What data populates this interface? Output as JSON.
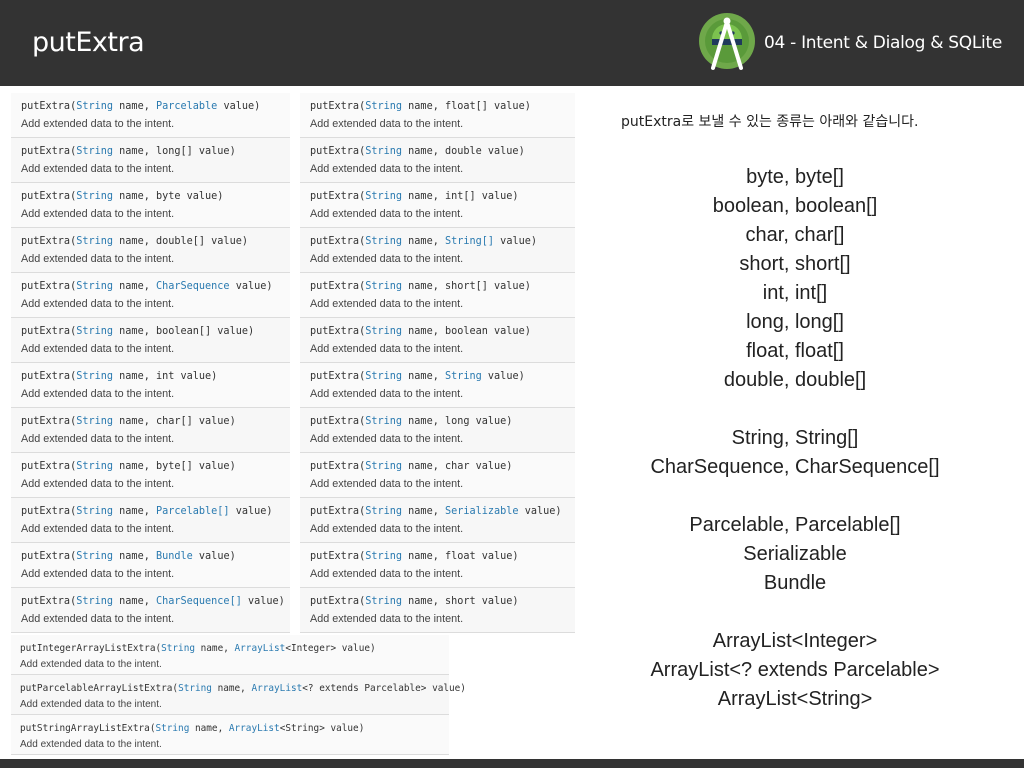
{
  "header": {
    "title": "putExtra",
    "chapter": "04 - Intent & Dialog & SQLite",
    "logo_icon": "android-studio-logo-icon",
    "background_color": "#333333"
  },
  "left_column": [
    {
      "method": "putExtra",
      "pre": "(",
      "type": "String",
      "mid": " name, ",
      "ptype": "Parcelable",
      "post": " value)",
      "desc": "Add extended data to the intent."
    },
    {
      "method": "putExtra",
      "pre": "(",
      "type": "String",
      "mid": " name, ",
      "ptype": "",
      "post": "long[] value)",
      "desc": "Add extended data to the intent."
    },
    {
      "method": "putExtra",
      "pre": "(",
      "type": "String",
      "mid": " name, ",
      "ptype": "",
      "post": "byte value)",
      "desc": "Add extended data to the intent."
    },
    {
      "method": "putExtra",
      "pre": "(",
      "type": "String",
      "mid": " name, ",
      "ptype": "",
      "post": "double[] value)",
      "desc": "Add extended data to the intent."
    },
    {
      "method": "putExtra",
      "pre": "(",
      "type": "String",
      "mid": " name, ",
      "ptype": "CharSequence",
      "post": " value)",
      "desc": "Add extended data to the intent."
    },
    {
      "method": "putExtra",
      "pre": "(",
      "type": "String",
      "mid": " name, ",
      "ptype": "",
      "post": "boolean[] value)",
      "desc": "Add extended data to the intent."
    },
    {
      "method": "putExtra",
      "pre": "(",
      "type": "String",
      "mid": " name, ",
      "ptype": "",
      "post": "int value)",
      "desc": "Add extended data to the intent."
    },
    {
      "method": "putExtra",
      "pre": "(",
      "type": "String",
      "mid": " name, ",
      "ptype": "",
      "post": "char[] value)",
      "desc": "Add extended data to the intent."
    },
    {
      "method": "putExtra",
      "pre": "(",
      "type": "String",
      "mid": " name, ",
      "ptype": "",
      "post": "byte[] value)",
      "desc": "Add extended data to the intent."
    },
    {
      "method": "putExtra",
      "pre": "(",
      "type": "String",
      "mid": " name, ",
      "ptype": "Parcelable[]",
      "post": " value)",
      "desc": "Add extended data to the intent."
    },
    {
      "method": "putExtra",
      "pre": "(",
      "type": "String",
      "mid": " name, ",
      "ptype": "Bundle",
      "post": " value)",
      "desc": "Add extended data to the intent."
    },
    {
      "method": "putExtra",
      "pre": "(",
      "type": "String",
      "mid": " name, ",
      "ptype": "CharSequence[]",
      "post": " value)",
      "desc": "Add extended data to the intent."
    }
  ],
  "right_column": [
    {
      "method": "putExtra",
      "pre": "(",
      "type": "String",
      "mid": " name, ",
      "ptype": "",
      "post": "float[] value)",
      "desc": "Add extended data to the intent."
    },
    {
      "method": "putExtra",
      "pre": "(",
      "type": "String",
      "mid": " name, ",
      "ptype": "",
      "post": "double value)",
      "desc": "Add extended data to the intent."
    },
    {
      "method": "putExtra",
      "pre": "(",
      "type": "String",
      "mid": " name, ",
      "ptype": "",
      "post": "int[] value)",
      "desc": "Add extended data to the intent."
    },
    {
      "method": "putExtra",
      "pre": "(",
      "type": "String",
      "mid": " name, ",
      "ptype": "String[]",
      "post": " value)",
      "desc": "Add extended data to the intent."
    },
    {
      "method": "putExtra",
      "pre": "(",
      "type": "String",
      "mid": " name, ",
      "ptype": "",
      "post": "short[] value)",
      "desc": "Add extended data to the intent."
    },
    {
      "method": "putExtra",
      "pre": "(",
      "type": "String",
      "mid": " name, ",
      "ptype": "",
      "post": "boolean value)",
      "desc": "Add extended data to the intent."
    },
    {
      "method": "putExtra",
      "pre": "(",
      "type": "String",
      "mid": " name, ",
      "ptype": "String",
      "post": " value)",
      "desc": "Add extended data to the intent."
    },
    {
      "method": "putExtra",
      "pre": "(",
      "type": "String",
      "mid": " name, ",
      "ptype": "",
      "post": "long value)",
      "desc": "Add extended data to the intent."
    },
    {
      "method": "putExtra",
      "pre": "(",
      "type": "String",
      "mid": " name, ",
      "ptype": "",
      "post": "char value)",
      "desc": "Add extended data to the intent."
    },
    {
      "method": "putExtra",
      "pre": "(",
      "type": "String",
      "mid": " name, ",
      "ptype": "Serializable",
      "post": " value)",
      "desc": "Add extended data to the intent."
    },
    {
      "method": "putExtra",
      "pre": "(",
      "type": "String",
      "mid": " name, ",
      "ptype": "",
      "post": "float value)",
      "desc": "Add extended data to the intent."
    },
    {
      "method": "putExtra",
      "pre": "(",
      "type": "String",
      "mid": " name, ",
      "ptype": "",
      "post": "short value)",
      "desc": "Add extended data to the intent."
    }
  ],
  "bottom_column": [
    {
      "method": "putIntegerArrayListExtra",
      "pre": "(",
      "type": "String",
      "mid": " name, ",
      "ptype": "ArrayList",
      "post": "<Integer> value)",
      "desc": "Add extended data to the intent."
    },
    {
      "method": "putParcelableArrayListExtra",
      "pre": "(",
      "type": "String",
      "mid": " name, ",
      "ptype": "ArrayList",
      "post": "<? extends Parcelable> value)",
      "desc": "Add extended data to the intent."
    },
    {
      "method": "putStringArrayListExtra",
      "pre": "(",
      "type": "String",
      "mid": " name, ",
      "ptype": "ArrayList",
      "post": "<String> value)",
      "desc": "Add extended data to the intent."
    }
  ],
  "intro": "putExtra로 보낼 수 있는 종류는 아래와 같습니다.",
  "types": [
    "byte, byte[]",
    "boolean, boolean[]",
    "char, char[]",
    "short, short[]",
    "int, int[]",
    "long, long[]",
    "float, float[]",
    "double, double[]",
    "",
    "String, String[]",
    "CharSequence, CharSequence[]",
    "",
    "Parcelable, Parcelable[]",
    "Serializable",
    "Bundle",
    "",
    "ArrayList<Integer>",
    "ArrayList<? extends Parcelable>",
    "ArrayList<String>"
  ]
}
